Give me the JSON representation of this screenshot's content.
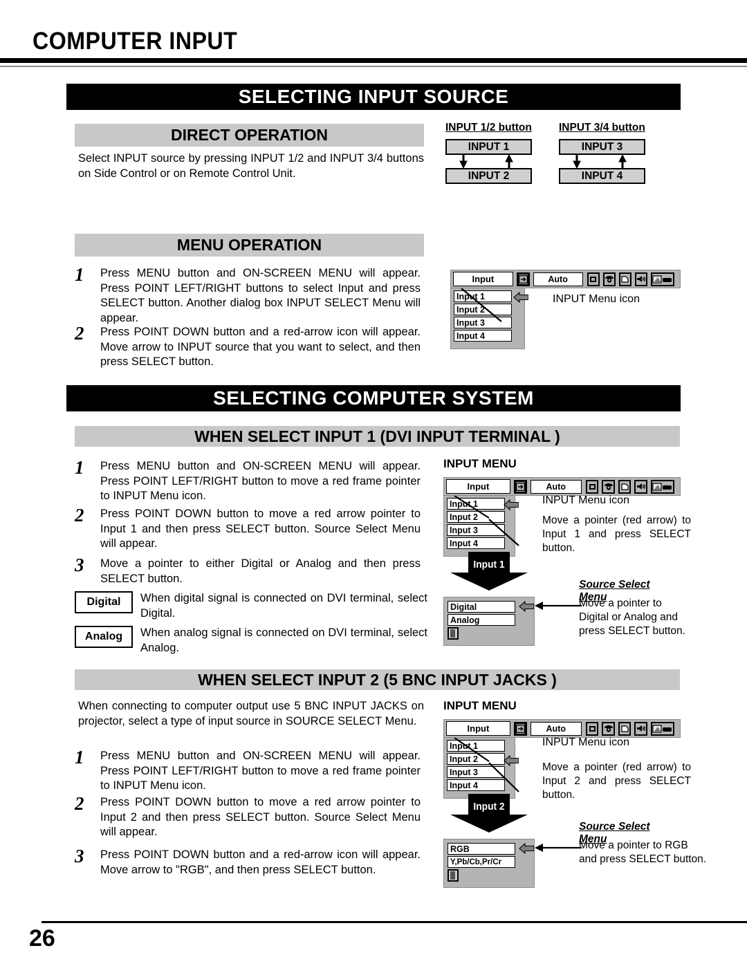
{
  "page": {
    "title": "COMPUTER INPUT",
    "number": "26"
  },
  "banners": {
    "input_source": "SELECTING INPUT SOURCE",
    "computer_system": "SELECTING COMPUTER SYSTEM"
  },
  "direct_operation": {
    "heading": "DIRECT OPERATION",
    "body": "Select INPUT source by pressing INPUT 1/2 and INPUT 3/4 buttons on Side Control or on Remote Control Unit.",
    "button_groups": [
      {
        "title": "INPUT 1/2 button",
        "top": "INPUT 1",
        "bottom": "INPUT 2"
      },
      {
        "title": "INPUT 3/4 button",
        "top": "INPUT 3",
        "bottom": "INPUT 4"
      }
    ]
  },
  "menu_operation": {
    "heading": "MENU OPERATION",
    "steps": [
      {
        "num": "1",
        "text": "Press MENU button and ON-SCREEN MENU will appear.  Press POINT LEFT/RIGHT buttons to select Input and press  SELECT button.  Another dialog box INPUT SELECT Menu will appear."
      },
      {
        "num": "2",
        "text": "Press POINT DOWN button and a red-arrow icon will appear. Move arrow to INPUT source that you want to select, and then press SELECT button."
      }
    ],
    "osd": {
      "tab_label": "Input",
      "auto_label": "Auto",
      "items": [
        "Input 1",
        "Input 2",
        "Input 3",
        "Input 4"
      ],
      "selected_item": "Input 1",
      "callout": "INPUT Menu icon"
    }
  },
  "dvi_section": {
    "heading": "WHEN SELECT  INPUT 1 (DVI INPUT TERMINAL )",
    "steps": [
      {
        "num": "1",
        "text": "Press MENU button and ON-SCREEN MENU will appear.  Press POINT LEFT/RIGHT button to move a red frame pointer to INPUT Menu icon."
      },
      {
        "num": "2",
        "text": "Press POINT DOWN button to move a red arrow pointer to Input 1 and then press SELECT button.  Source Select Menu will appear."
      },
      {
        "num": "3",
        "text": "Move a pointer to either Digital or Analog and then press SELECT button."
      }
    ],
    "key_rows": [
      {
        "key": "Digital",
        "desc": "When digital signal is connected on DVI terminal, select Digital."
      },
      {
        "key": "Analog",
        "desc": "When analog signal is connected on DVI terminal, select Analog."
      }
    ],
    "osd": {
      "menu_header": "INPUT MENU",
      "tab_label": "Input",
      "auto_label": "Auto",
      "items": [
        "Input 1",
        "Input 2",
        "Input 3",
        "Input 4"
      ],
      "selected_item": "Input 1",
      "callout_icon": "INPUT Menu icon",
      "callout_pointer": "Move a pointer (red arrow) to Input 1 and press SELECT button.",
      "down_banner": "Input 1",
      "source_select_header": "Source Select Menu",
      "source_items": [
        "Digital",
        "Analog"
      ],
      "source_selected": "Digital",
      "source_callout": "Move a pointer to Digital or Analog and press SELECT button."
    }
  },
  "bnc_section": {
    "heading": "WHEN SELECT INPUT 2 (5 BNC INPUT JACKS )",
    "body": "When connecting to computer output use 5 BNC INPUT JACKS on projector, select a type of input source in SOURCE SELECT Menu.",
    "steps": [
      {
        "num": "1",
        "text": "Press MENU button and ON-SCREEN MENU will appear.  Press POINT LEFT/RIGHT button to move a red frame pointer to INPUT Menu icon."
      },
      {
        "num": "2",
        "text": "Press POINT DOWN button to move a red arrow pointer to Input 2 and then press SELECT button.  Source Select Menu will appear."
      },
      {
        "num": "3",
        "text": "Press POINT DOWN button and a red-arrow icon will appear. Move arrow to \"RGB\", and then press SELECT button."
      }
    ],
    "osd": {
      "menu_header": "INPUT MENU",
      "tab_label": "Input",
      "auto_label": "Auto",
      "items": [
        "Input 1",
        "Input 2",
        "Input 3",
        "Input 4"
      ],
      "selected_item": "Input 2",
      "callout_icon": "INPUT Menu icon",
      "callout_pointer": "Move a pointer (red arrow) to Input 2 and press SELECT button.",
      "down_banner": "Input 2",
      "source_select_header": "Source Select Menu",
      "source_items": [
        "RGB",
        "Y,Pb/Cb,Pr/Cr"
      ],
      "source_selected": "RGB",
      "source_callout": "Move a pointer to RGB and press SELECT button."
    }
  },
  "icons": {
    "input_menu": "input-menu-icon",
    "screen": "screen-icon",
    "color": "color-adjust-icon",
    "pc_adjust": "pc-adjust-icon",
    "sound": "sound-icon",
    "setting": "setting-icon",
    "exit": "exit-door-icon",
    "red_pointer": "red-arrow-pointer-icon"
  },
  "colors": {
    "banner_bg": "#000000",
    "subbar_bg": "#c8c8c8",
    "osd_gray": "#b4b4b4",
    "button_gray": "#cfcfcf"
  }
}
